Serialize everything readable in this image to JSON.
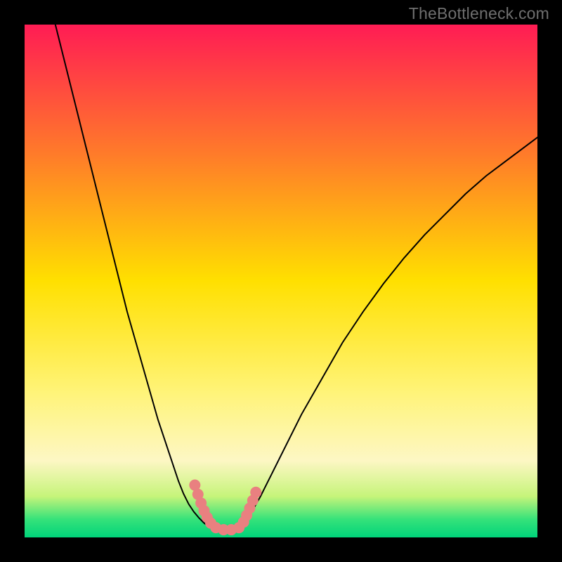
{
  "watermark": "TheBottleneck.com",
  "chart_data": {
    "type": "line",
    "title": "",
    "xlabel": "",
    "ylabel": "",
    "xlim": [
      0,
      100
    ],
    "ylim": [
      0,
      100
    ],
    "grid": false,
    "background_gradient": {
      "stops": [
        {
          "offset": 0.0,
          "color": "#ff1c54"
        },
        {
          "offset": 0.25,
          "color": "#ff7a2a"
        },
        {
          "offset": 0.5,
          "color": "#ffe000"
        },
        {
          "offset": 0.72,
          "color": "#fff47a"
        },
        {
          "offset": 0.85,
          "color": "#fdf7c4"
        },
        {
          "offset": 0.92,
          "color": "#c6f47a"
        },
        {
          "offset": 0.965,
          "color": "#35e27a"
        },
        {
          "offset": 1.0,
          "color": "#00d37a"
        }
      ]
    },
    "series": [
      {
        "name": "left-branch",
        "color": "#000000",
        "stroke_width": 2,
        "x": [
          6,
          8,
          10,
          12,
          14,
          16,
          18,
          20,
          22,
          24,
          26,
          28,
          30,
          31,
          32,
          33,
          34,
          35,
          36
        ],
        "y": [
          100,
          92,
          84,
          76,
          68,
          60,
          52,
          44,
          37,
          30,
          23,
          17,
          11,
          8.5,
          6.5,
          5,
          3.8,
          2.8,
          2.1
        ]
      },
      {
        "name": "right-branch",
        "color": "#000000",
        "stroke_width": 2,
        "x": [
          42,
          44,
          46,
          48,
          50,
          54,
          58,
          62,
          66,
          70,
          74,
          78,
          82,
          86,
          90,
          94,
          98,
          100
        ],
        "y": [
          2.1,
          4.5,
          8,
          12,
          16,
          24,
          31,
          38,
          44,
          49.5,
          54.5,
          59,
          63,
          67,
          70.5,
          73.5,
          76.5,
          78
        ]
      },
      {
        "name": "valley-floor",
        "color": "#000000",
        "stroke_width": 2,
        "x": [
          36,
          37,
          38,
          39,
          40,
          41,
          42
        ],
        "y": [
          2.1,
          1.6,
          1.3,
          1.2,
          1.3,
          1.6,
          2.1
        ]
      }
    ],
    "markers": [
      {
        "name": "valley-marker-left-descend",
        "color": "#e98080",
        "radius": 8,
        "points": [
          {
            "x": 33.2,
            "y": 10.2
          },
          {
            "x": 33.8,
            "y": 8.4
          },
          {
            "x": 34.4,
            "y": 6.7
          },
          {
            "x": 35.0,
            "y": 5.2
          },
          {
            "x": 35.6,
            "y": 3.9
          },
          {
            "x": 36.3,
            "y": 2.8
          }
        ]
      },
      {
        "name": "valley-marker-floor",
        "color": "#e98080",
        "radius": 8,
        "points": [
          {
            "x": 37.3,
            "y": 1.9
          },
          {
            "x": 38.8,
            "y": 1.5
          },
          {
            "x": 40.3,
            "y": 1.5
          },
          {
            "x": 41.8,
            "y": 1.9
          }
        ]
      },
      {
        "name": "valley-marker-right-ascend",
        "color": "#e98080",
        "radius": 8,
        "points": [
          {
            "x": 42.7,
            "y": 3.0
          },
          {
            "x": 43.3,
            "y": 4.3
          },
          {
            "x": 43.9,
            "y": 5.7
          },
          {
            "x": 44.5,
            "y": 7.2
          },
          {
            "x": 45.1,
            "y": 8.8
          }
        ]
      }
    ]
  }
}
